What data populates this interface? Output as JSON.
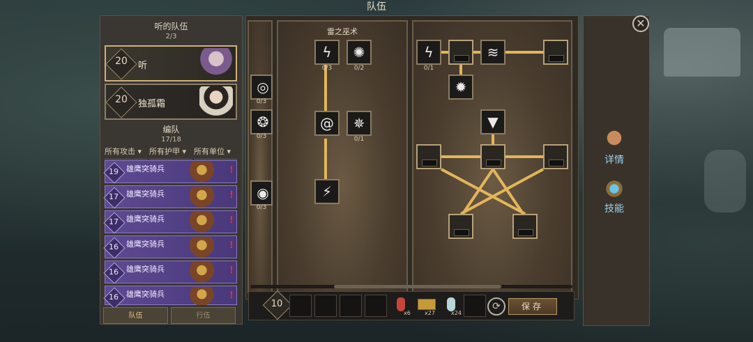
{
  "window_title": "队伍",
  "party": {
    "title": "听的队伍",
    "count": "2/3",
    "members": [
      {
        "level": "20",
        "name": "听"
      },
      {
        "level": "20",
        "name": "独孤霜"
      }
    ]
  },
  "formation": {
    "title": "编队",
    "count": "17/18",
    "filters": [
      "所有攻击",
      "所有护甲",
      "所有单位"
    ],
    "units": [
      {
        "level": "19",
        "name": "雄鹰突骑兵"
      },
      {
        "level": "17",
        "name": "雄鹰突骑兵"
      },
      {
        "level": "17",
        "name": "雄鹰突骑兵"
      },
      {
        "level": "16",
        "name": "雄鹰突骑兵"
      },
      {
        "level": "16",
        "name": "雄鹰突骑兵"
      },
      {
        "level": "16",
        "name": "雄鹰突骑兵"
      }
    ]
  },
  "bottom_tabs": [
    "队伍",
    "行伍"
  ],
  "skill_tree": {
    "column_title": "雷之巫术",
    "left_counts": [
      "0/3",
      "0/3",
      "0/3"
    ],
    "mid_counts": [
      "0/3",
      "0/2",
      "0/1"
    ],
    "right_counts": [
      "0/1"
    ]
  },
  "bottom_bar": {
    "level": "10",
    "items": [
      {
        "name": "red-potion",
        "count": "x6"
      },
      {
        "name": "meat-crate",
        "count": "x27"
      },
      {
        "name": "blue-potion",
        "count": "x24"
      }
    ],
    "save_label": "保存"
  },
  "side_tabs": [
    "详情",
    "技能"
  ],
  "colors": {
    "gold_line": "#e2b65a",
    "unit_bg": "#5e4a92",
    "accent": "#cdb27a"
  }
}
